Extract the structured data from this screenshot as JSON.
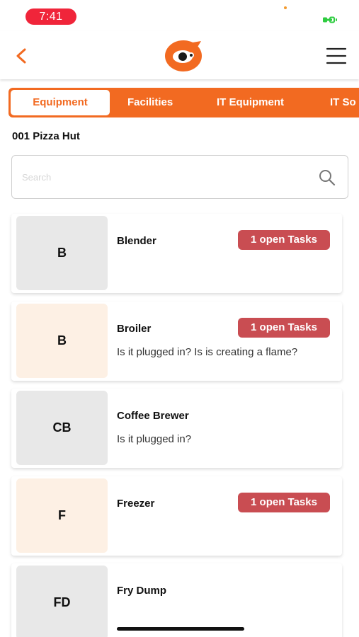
{
  "status_bar": {
    "time": "7:41",
    "colors": {
      "time_pill": "#f0253a",
      "battery": "#2ecc40"
    }
  },
  "nav": {
    "back_icon": "chevron-left-icon",
    "logo_icon": "owl-eye-logo",
    "menu_icon": "hamburger-menu-icon",
    "accent": "#f26a21"
  },
  "tabs": [
    {
      "label": "Equipment",
      "active": true
    },
    {
      "label": "Facilities",
      "active": false
    },
    {
      "label": "IT Equipment",
      "active": false
    },
    {
      "label": "IT So",
      "active": false
    }
  ],
  "store_name": "001 Pizza Hut",
  "search": {
    "placeholder": "Search",
    "value": "",
    "icon": "search-icon"
  },
  "items": [
    {
      "initials": "B",
      "name": "Blender",
      "badge": "1 open Tasks",
      "description": ""
    },
    {
      "initials": "B",
      "name": "Broiler",
      "badge": "1 open Tasks",
      "description": "Is it plugged in? Is is creating a flame?"
    },
    {
      "initials": "CB",
      "name": "Coffee Brewer",
      "badge": "",
      "description": "Is it plugged in?"
    },
    {
      "initials": "F",
      "name": "Freezer",
      "badge": "1 open Tasks",
      "description": ""
    },
    {
      "initials": "FD",
      "name": "Fry Dump",
      "badge": "",
      "description": ""
    }
  ],
  "colors": {
    "badge": "#c94d52",
    "avatar_gray": "#e8e8e8",
    "avatar_peach": "#fdf0e4"
  }
}
